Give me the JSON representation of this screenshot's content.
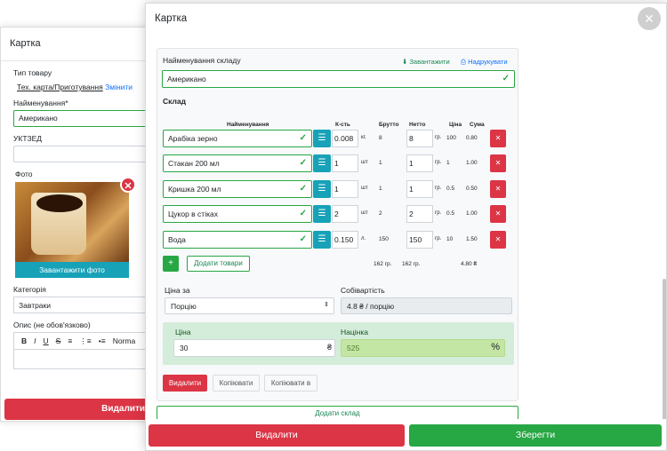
{
  "background_panel": {
    "title": "Картка",
    "product_type_label": "Тип товару",
    "product_type_value": "Тех. карта/Приготування",
    "change_link": "Змінити",
    "name_label": "Найменування*",
    "name_value": "Американо",
    "uktzed_label": "УКТЗЕД",
    "photo_label": "Фото",
    "upload_photo": "Завантажити фото",
    "category_label": "Категорія",
    "category_value": "Завтраки",
    "description_label": "Опис (не обов'язково)",
    "toolbar": [
      "B",
      "I",
      "U",
      "S",
      "≡",
      "⋮≡",
      "•≡",
      "Norma"
    ],
    "delete_label": "Видалити"
  },
  "modal": {
    "title": "Картка",
    "warehouse_name_label": "Найменування складу",
    "download_link": "Завантажити",
    "print_link": "Надрукувати",
    "warehouse_name_value": "Американо",
    "composition_title": "Склад",
    "headers": {
      "name": "Найменування",
      "qty": "К-сть",
      "brutto": "Брутто",
      "netto": "Нетто",
      "price": "Ціна",
      "sum": "Сума"
    },
    "ingredients": [
      {
        "name": "Арабіка зерно",
        "qty": "0.008",
        "unit": "кг.",
        "brutto": "8",
        "netto": "8",
        "netto_unit": "гр.",
        "price": "100",
        "sum": "0.80"
      },
      {
        "name": "Стакан 200 мл",
        "qty": "1",
        "unit": "шт",
        "brutto": "1",
        "netto": "1",
        "netto_unit": "гр.",
        "price": "1",
        "sum": "1.00"
      },
      {
        "name": "Кришка 200 мл",
        "qty": "1",
        "unit": "шт",
        "brutto": "1",
        "netto": "1",
        "netto_unit": "гр.",
        "price": "0.5",
        "sum": "0.50"
      },
      {
        "name": "Цукор в стіках",
        "qty": "2",
        "unit": "шт",
        "brutto": "2",
        "netto": "2",
        "netto_unit": "гр.",
        "price": "0.5",
        "sum": "1.00"
      },
      {
        "name": "Вода",
        "qty": "0.150",
        "unit": "л.",
        "brutto": "150",
        "netto": "150",
        "netto_unit": "гр.",
        "price": "10",
        "sum": "1.50"
      }
    ],
    "add_goods_label": "Додати товари",
    "totals": {
      "brutto": "162 гр.",
      "netto": "162 гр.",
      "sum": "4.80 ₴"
    },
    "price_for_label": "Ціна за",
    "price_for_value": "Порцію",
    "cost_label": "Собівартість",
    "cost_value": "4.8 ₴ / порцію",
    "price_label": "Ціна",
    "price_value": "30",
    "currency_symbol": "₴",
    "markup_label": "Націнка",
    "markup_value": "525",
    "percent_symbol": "%",
    "delete_label": "Видалити",
    "copy_label": "Копіювати",
    "copy_to_label": "Копіювати в",
    "add_warehouse_label": "Додати склад",
    "footer_delete": "Видалити",
    "footer_save": "Зберегти"
  }
}
